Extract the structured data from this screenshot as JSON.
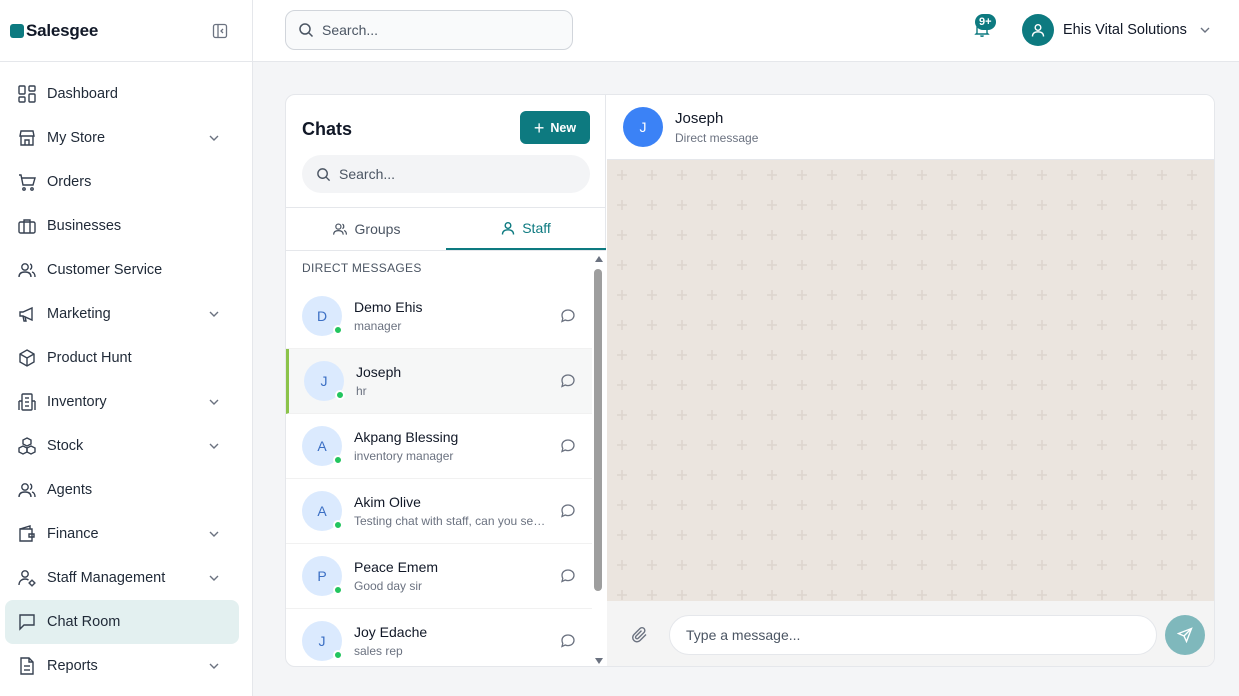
{
  "brand": {
    "name": "Salesgee"
  },
  "sidebar": {
    "items": [
      {
        "label": "Dashboard",
        "icon": "dashboard-icon",
        "chevron": false
      },
      {
        "label": "My Store",
        "icon": "store-icon",
        "chevron": true
      },
      {
        "label": "Orders",
        "icon": "cart-icon",
        "chevron": false
      },
      {
        "label": "Businesses",
        "icon": "briefcase-icon",
        "chevron": false
      },
      {
        "label": "Customer Service",
        "icon": "users-icon",
        "chevron": false
      },
      {
        "label": "Marketing",
        "icon": "megaphone-icon",
        "chevron": true
      },
      {
        "label": "Product Hunt",
        "icon": "package-icon",
        "chevron": false
      },
      {
        "label": "Inventory",
        "icon": "building-icon",
        "chevron": true
      },
      {
        "label": "Stock",
        "icon": "boxes-icon",
        "chevron": true
      },
      {
        "label": "Agents",
        "icon": "users-icon",
        "chevron": false
      },
      {
        "label": "Finance",
        "icon": "wallet-icon",
        "chevron": true
      },
      {
        "label": "Staff Management",
        "icon": "user-cog-icon",
        "chevron": true
      },
      {
        "label": "Chat Room",
        "icon": "chat-icon",
        "chevron": false,
        "active": true
      },
      {
        "label": "Reports",
        "icon": "file-icon",
        "chevron": true
      }
    ]
  },
  "topbar": {
    "search_placeholder": "Search...",
    "notifications_badge": "9+",
    "user_name": "Ehis Vital Solutions"
  },
  "chats": {
    "title": "Chats",
    "new_label": "New",
    "search_placeholder": "Search...",
    "tabs": [
      {
        "label": "Groups",
        "active": false
      },
      {
        "label": "Staff",
        "active": true
      }
    ],
    "section_label": "DIRECT MESSAGES",
    "contacts": [
      {
        "initial": "D",
        "name": "Demo Ehis",
        "subtitle": "manager",
        "online": true
      },
      {
        "initial": "J",
        "name": "Joseph",
        "subtitle": "hr",
        "online": true,
        "active": true
      },
      {
        "initial": "A",
        "name": "Akpang Blessing",
        "subtitle": "inventory manager",
        "online": true
      },
      {
        "initial": "A",
        "name": "Akim Olive",
        "subtitle": "Testing chat with staff, can you see this?",
        "online": true
      },
      {
        "initial": "P",
        "name": "Peace Emem",
        "subtitle": "Good day sir",
        "online": true
      },
      {
        "initial": "J",
        "name": "Joy Edache",
        "subtitle": "sales rep",
        "online": true
      }
    ]
  },
  "conversation": {
    "initial": "J",
    "name": "Joseph",
    "subtitle": "Direct message",
    "composer_placeholder": "Type a message..."
  },
  "colors": {
    "accent": "#0d7a80",
    "chat_background": "#ebe5df",
    "online": "#22c55e",
    "active_row_border": "#8bc34a"
  }
}
